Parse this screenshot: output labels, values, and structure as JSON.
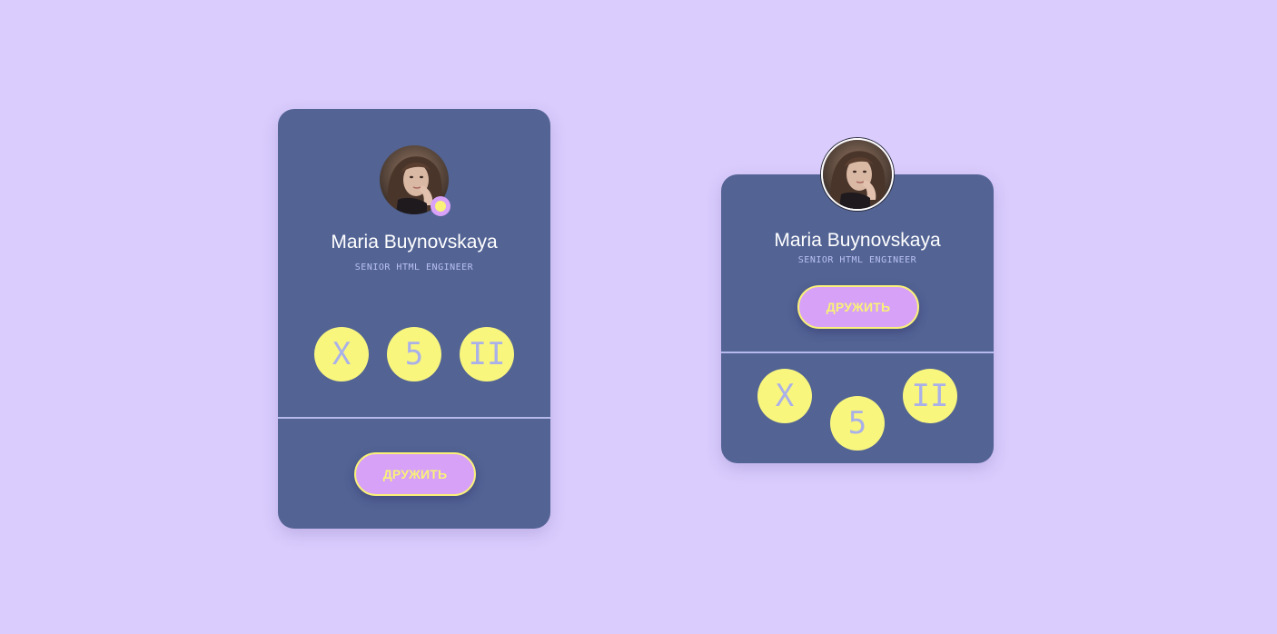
{
  "colors": {
    "page_background": "#dacdfd",
    "card_background": "#526394",
    "badge_background": "#f9f67e",
    "badge_text": "#aab1e8",
    "button_background": "#d6a1f7",
    "button_text": "#f9f178",
    "divider": "#b7b8ec",
    "status_dot": "#f9f178"
  },
  "cards": [
    {
      "avatar_icon": "user-photo",
      "online_status_icon": "status-dot-icon",
      "name": "Maria Buynovskaya",
      "role": "SENIOR HTML ENGINEER",
      "badges": [
        "X",
        "5",
        "II"
      ],
      "button_label": "ДРУЖИТЬ"
    },
    {
      "avatar_icon": "user-photo",
      "name": "Maria Buynovskaya",
      "role": "SENIOR HTML ENGINEER",
      "badges": [
        "X",
        "5",
        "II"
      ],
      "button_label": "ДРУЖИТЬ"
    }
  ]
}
